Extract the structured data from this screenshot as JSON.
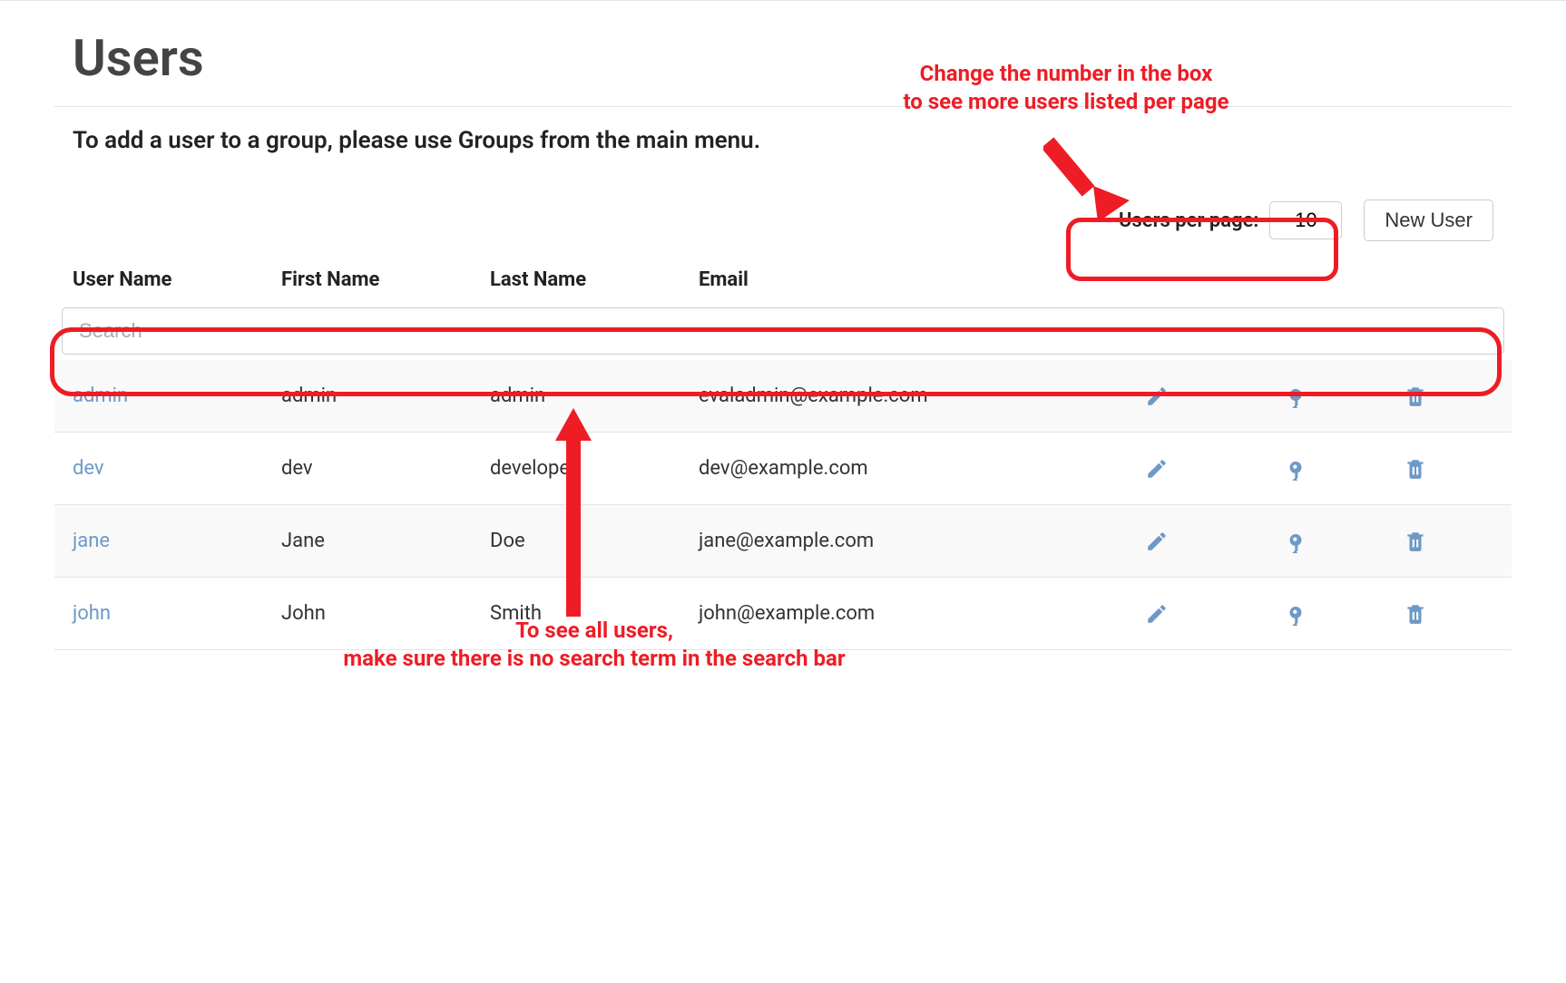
{
  "page": {
    "title": "Users",
    "subtitle": "To add a user to a group, please use Groups from the main menu."
  },
  "controls": {
    "users_per_page_label": "Users per page:",
    "users_per_page_value": "10",
    "new_user_label": "New User"
  },
  "table": {
    "headers": {
      "username": "User Name",
      "firstname": "First Name",
      "lastname": "Last Name",
      "email": "Email"
    },
    "search_placeholder": "Search",
    "rows": [
      {
        "username": "admin",
        "firstname": "admin",
        "lastname": "admin",
        "email": "evaladmin@example.com"
      },
      {
        "username": "dev",
        "firstname": "dev",
        "lastname": "developer",
        "email": "dev@example.com"
      },
      {
        "username": "jane",
        "firstname": "Jane",
        "lastname": "Doe",
        "email": "jane@example.com"
      },
      {
        "username": "john",
        "firstname": "John",
        "lastname": "Smith",
        "email": "john@example.com"
      }
    ]
  },
  "annotations": {
    "top_line1": "Change the number in the box",
    "top_line2": "to see more users listed per page",
    "bottom_line1": "To see all users,",
    "bottom_line2": "make sure there is no search term in the search bar"
  },
  "icons": {
    "pencil": "pencil-icon",
    "key": "key-icon",
    "trash": "trash-icon"
  },
  "colors": {
    "annotation_red": "#ee1c25",
    "link_blue": "#6d99c6"
  }
}
